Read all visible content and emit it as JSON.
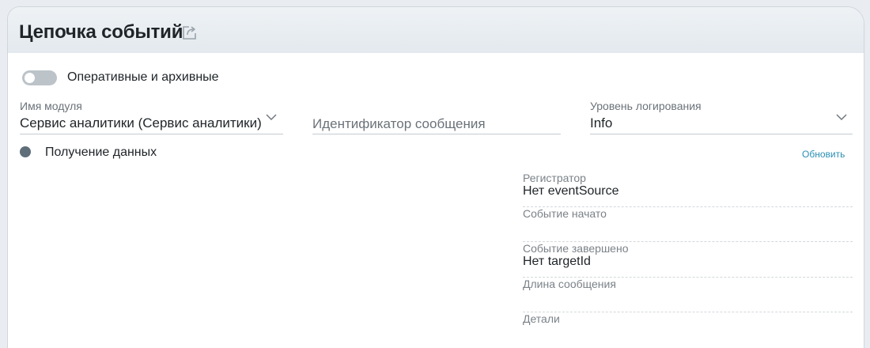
{
  "header": {
    "title": "Цепочка событий",
    "share_icon": "share-external-icon"
  },
  "toggle": {
    "label": "Оперативные и архивные",
    "state": "off"
  },
  "filters": {
    "module": {
      "label": "Имя модуля",
      "value": "Сервис аналитики (Сервис аналитики)"
    },
    "message_id": {
      "placeholder": "Идентификатор сообщения",
      "value": ""
    },
    "log_level": {
      "label": "Уровень логирования",
      "value": "Info"
    }
  },
  "status": {
    "text": "Получение данных"
  },
  "actions": {
    "refresh_label": "Обновить"
  },
  "details": [
    {
      "label": "Регистратор",
      "value": "Нет eventSource"
    },
    {
      "label": "Событие начато",
      "value": ""
    },
    {
      "label": "Событие завершено",
      "value": "Нет targetId"
    },
    {
      "label": "Длина сообщения",
      "value": ""
    },
    {
      "label": "Детали",
      "value": ""
    }
  ],
  "colors": {
    "accent_link": "#2b8fb3",
    "status_dot": "#5f6e79",
    "toggle_off": "#bcc3c9",
    "header_bg": "#e7ecf0"
  }
}
